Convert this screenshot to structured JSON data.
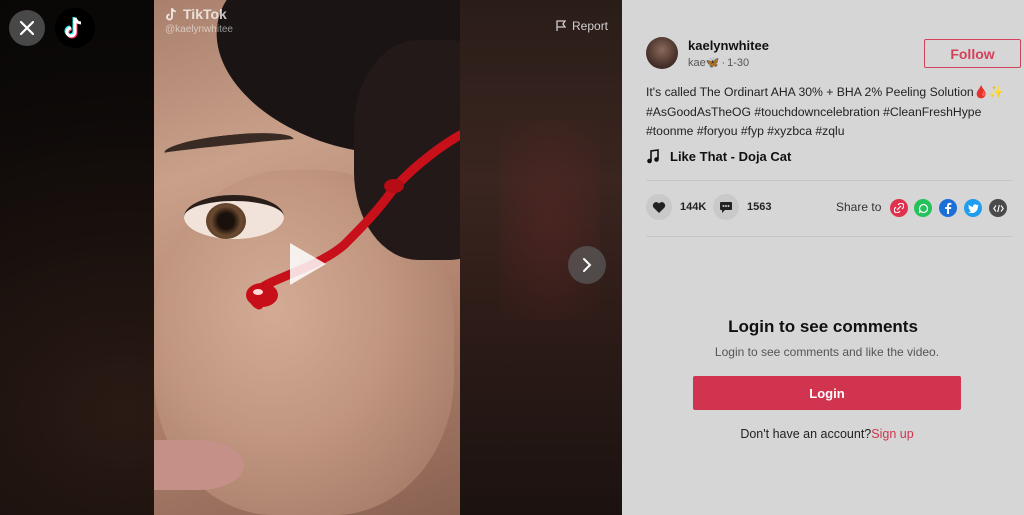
{
  "watermark": {
    "brand": "TikTok",
    "handle": "@kaelynwhitee"
  },
  "report_label": "Report",
  "post": {
    "username": "kaelynwhitee",
    "nickname": "kae🦋",
    "date": "1-30",
    "separator": " · ",
    "follow_label": "Follow",
    "description": "It's called The Ordinart AHA 30% + BHA 2% Peeling Solution🩸✨",
    "hashtags": "#AsGoodAsTheOG #touchdowncelebration #CleanFreshHype #toonme #foryou #fyp #xyzbca #zqlu",
    "music": "Like That - Doja Cat",
    "likes": "144K",
    "comments": "1563",
    "share_label": "Share to"
  },
  "share_targets": [
    {
      "name": "copy-link",
      "color": "#e0314e"
    },
    {
      "name": "whatsapp",
      "color": "#25c25c"
    },
    {
      "name": "facebook",
      "color": "#1c6fd6"
    },
    {
      "name": "twitter",
      "color": "#1d9ef0"
    },
    {
      "name": "embed",
      "color": "#4a4a4a"
    }
  ],
  "login": {
    "title": "Login to see comments",
    "subtitle": "Login to see comments and like the video.",
    "button": "Login",
    "no_account": "Don't have an account?",
    "signup": "Sign up"
  },
  "colors": {
    "accent": "#d1344f",
    "panel_bg": "#d6d6d6"
  }
}
